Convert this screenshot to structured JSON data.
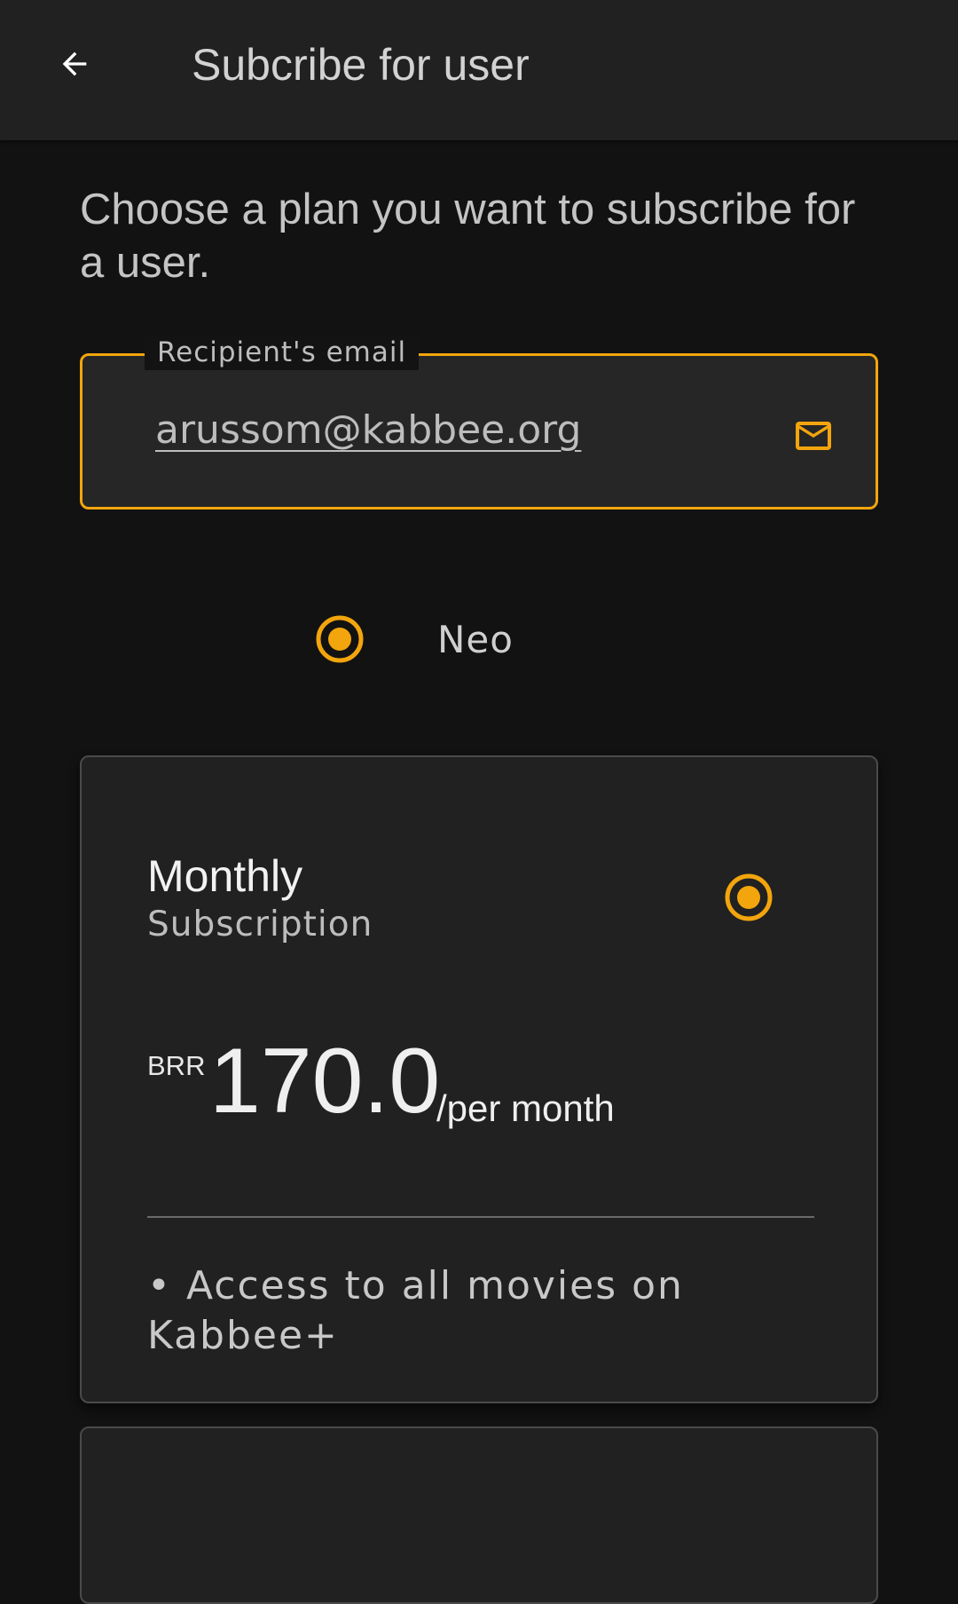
{
  "appbar": {
    "title": "Subcribe for user",
    "back_icon": "arrow-left-icon"
  },
  "intro": "Choose a plan you want to subscribe for a user.",
  "email_field": {
    "label": "Recipient's email",
    "value": "arussom@kabbee.org",
    "icon": "mail-icon"
  },
  "plan_group": {
    "selected_plan": "Neo"
  },
  "plans": [
    {
      "title": "Monthly",
      "subtitle": "Subscription",
      "currency": "BRR",
      "price": "170.0",
      "period": "/per month",
      "features": [
        "• Access to all movies on Kabbee+"
      ],
      "selected": true
    }
  ],
  "colors": {
    "accent": "#f2a50d",
    "background": "#121212",
    "surface": "#212121"
  }
}
